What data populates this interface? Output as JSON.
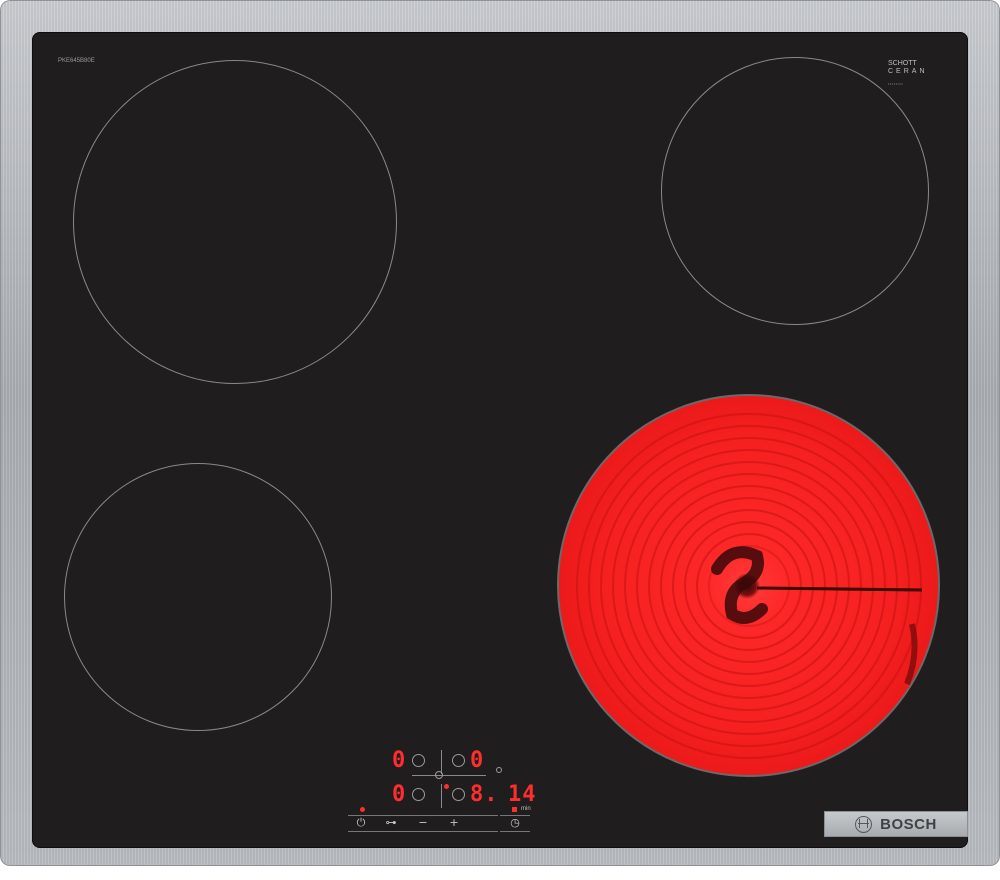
{
  "product": {
    "model_code": "PKE645B80E",
    "glass_brand_line1": "SCHOTT",
    "glass_brand_line2": "CERAN",
    "glass_brand_code": "••••••••",
    "brand": "BOSCH"
  },
  "display": {
    "zone_front_left_level": "0",
    "zone_rear_left_level": "0",
    "zone_front_right_level": "0",
    "zone_rear_right_level": "8.",
    "timer_value": "14",
    "timer_unit": "min"
  },
  "controls": {
    "power_symbol": "⏻",
    "childlock_symbol": "⊶",
    "minus_symbol": "−",
    "plus_symbol": "+",
    "timer_symbol": "◷"
  },
  "colors": {
    "glass": "#201d1e",
    "frame": "#b3b7bc",
    "zone_outline": "#8a8889",
    "hot_zone": "#f52020",
    "led": "#ff2d2d"
  }
}
